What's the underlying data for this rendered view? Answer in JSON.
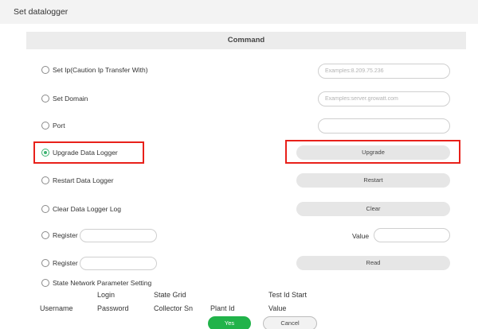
{
  "dialog": {
    "title": "Set datalogger"
  },
  "command": {
    "header": "Command"
  },
  "rows": {
    "set_ip": {
      "label": "Set Ip(Caution Ip Transfer With)",
      "placeholder": "Examples:8.209.75.236"
    },
    "set_domain": {
      "label": "Set Domain",
      "placeholder": "Examples:server.growatt.com"
    },
    "port": {
      "label": "Port",
      "placeholder": ""
    },
    "upgrade": {
      "label": "Upgrade Data Logger",
      "button": "Upgrade",
      "selected": true
    },
    "restart": {
      "label": "Restart Data Logger",
      "button": "Restart"
    },
    "clear": {
      "label": "Clear Data Logger Log",
      "button": "Clear"
    },
    "register_write": {
      "label": "Register",
      "value_label": "Value"
    },
    "register_read": {
      "label": "Register",
      "button": "Read"
    },
    "state_network": {
      "label": "State Network Parameter Setting"
    }
  },
  "param_columns": {
    "username": "Username",
    "login_password_1": "Login",
    "login_password_2": "Password",
    "state_grid_1": "State Grid",
    "state_grid_2": "Collector Sn",
    "plant_id": "Plant Id",
    "test_id_1": "Test Id Start",
    "test_id_2": "Value"
  },
  "footer": {
    "yes": "Yes",
    "cancel": "Cancel"
  },
  "colors": {
    "accent_green": "#21b34a",
    "highlight_red": "#e8201a",
    "pill_gray": "#e6e6e6"
  }
}
